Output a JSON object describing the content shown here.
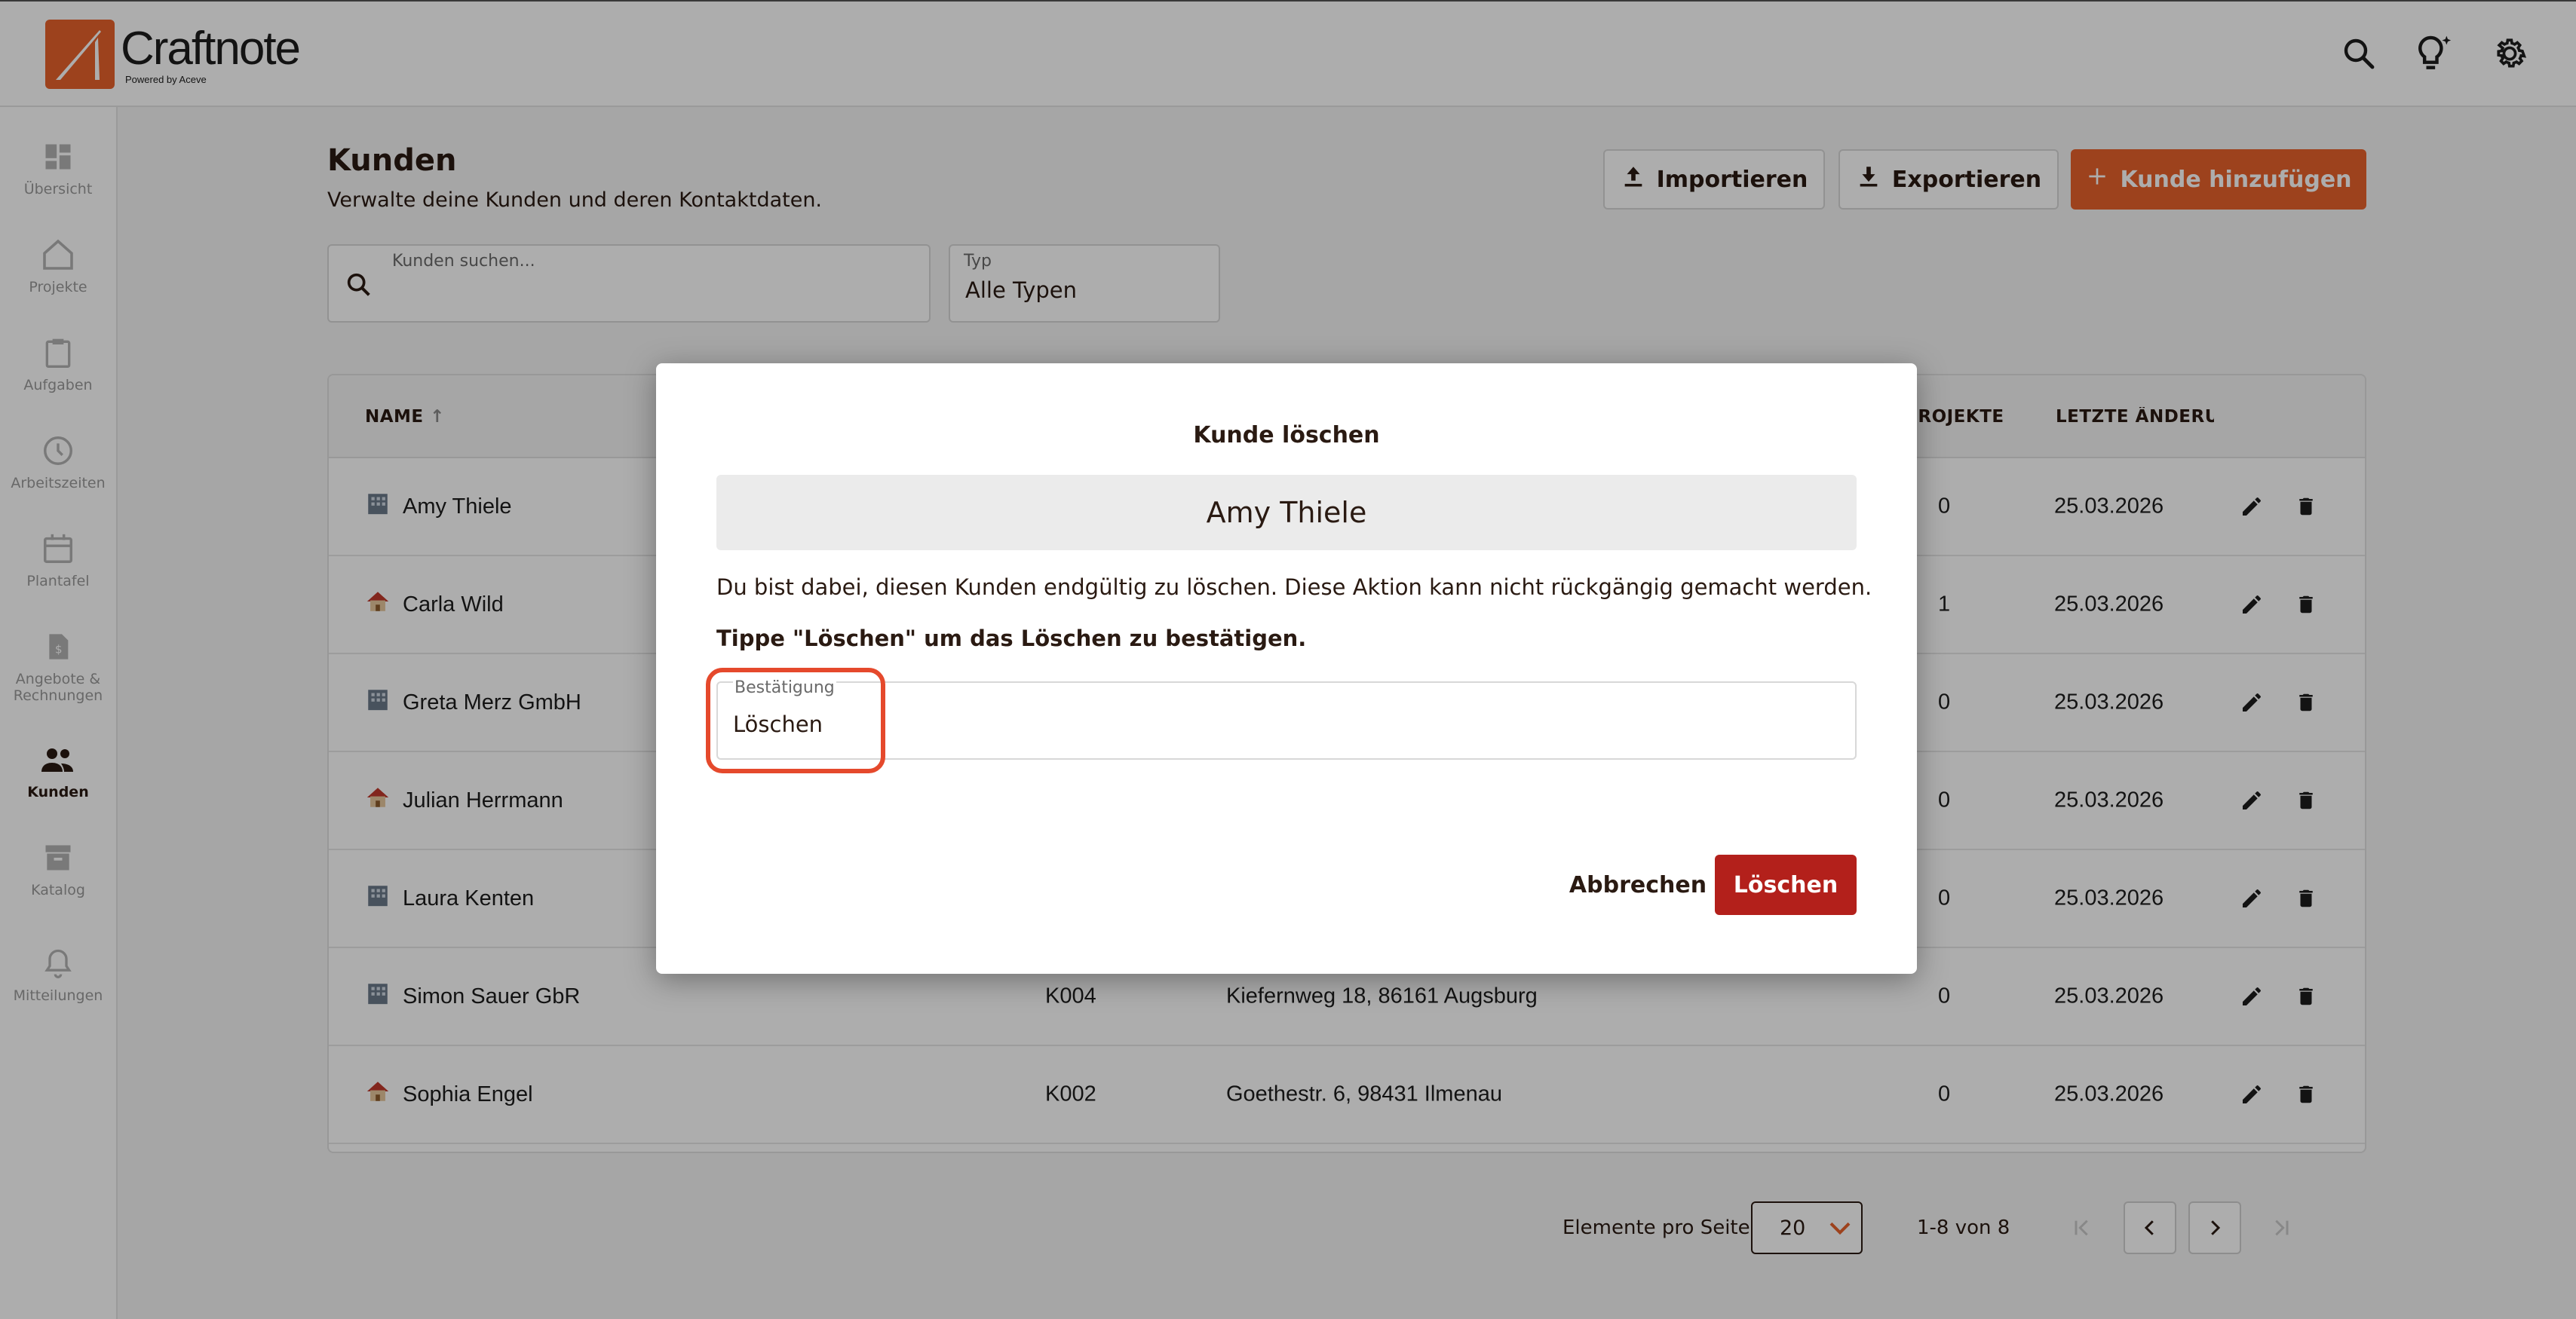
{
  "app": {
    "name": "Craftnote",
    "tagline": "Powered by Aceve"
  },
  "sidebar": {
    "items": [
      {
        "label": "Übersicht",
        "icon": "dashboard-icon"
      },
      {
        "label": "Projekte",
        "icon": "home-icon"
      },
      {
        "label": "Aufgaben",
        "icon": "clipboard-icon"
      },
      {
        "label": "Arbeitszeiten",
        "icon": "clock-icon"
      },
      {
        "label": "Plantafel",
        "icon": "calendar-icon"
      },
      {
        "label": "Angebote & Rechnungen",
        "icon": "invoice-icon"
      },
      {
        "label": "Kunden",
        "icon": "people-icon",
        "active": true
      },
      {
        "label": "Katalog",
        "icon": "archive-icon"
      },
      {
        "label": "Mitteilungen",
        "icon": "bell-icon"
      }
    ]
  },
  "header": {
    "title": "Kunden",
    "subtitle": "Verwalte deine Kunden und deren Kontaktdaten."
  },
  "toolbar": {
    "import_label": "Importieren",
    "export_label": "Exportieren",
    "add_label": "Kunde hinzufügen"
  },
  "filters": {
    "search_label": "Kunden suchen...",
    "type_label": "Typ",
    "type_value": "Alle Typen"
  },
  "table": {
    "columns": {
      "name": "NAME",
      "projects": "PROJEKTE",
      "changed": "LETZTE ÄNDERUNG"
    },
    "rows": [
      {
        "name": "Amy Thiele",
        "kind": "company",
        "number": "",
        "address": "",
        "projects": "0",
        "changed": "25.03.2026"
      },
      {
        "name": "Carla Wild",
        "kind": "private",
        "number": "",
        "address": "",
        "projects": "1",
        "changed": "25.03.2026"
      },
      {
        "name": "Greta Merz GmbH",
        "kind": "company",
        "number": "",
        "address": "",
        "projects": "0",
        "changed": "25.03.2026"
      },
      {
        "name": "Julian Herrmann",
        "kind": "private",
        "number": "",
        "address": "",
        "projects": "0",
        "changed": "25.03.2026"
      },
      {
        "name": "Laura Kenten",
        "kind": "company",
        "number": "",
        "address": "",
        "projects": "0",
        "changed": "25.03.2026"
      },
      {
        "name": "Simon Sauer GbR",
        "kind": "company",
        "number": "K004",
        "address": "Kiefernweg 18, 86161 Augsburg",
        "projects": "0",
        "changed": "25.03.2026"
      },
      {
        "name": "Sophia Engel",
        "kind": "private",
        "number": "K002",
        "address": "Goethestr. 6, 98431 Ilmenau",
        "projects": "0",
        "changed": "25.03.2026"
      }
    ]
  },
  "pagination": {
    "per_page_label": "Elemente pro Seite",
    "per_page": "20",
    "range": "1-8 von 8"
  },
  "dialog": {
    "title": "Kunde löschen",
    "customer_name": "Amy Thiele",
    "warning": "Du bist dabei, diesen Kunden endgültig zu löschen. Diese Aktion kann nicht rückgängig gemacht werden.",
    "instruction": "Tippe \"Löschen\" um das Löschen zu bestätigen.",
    "confirm_label": "Bestätigung",
    "confirm_value": "Löschen",
    "cancel_label": "Abbrechen",
    "delete_label": "Löschen"
  },
  "colors": {
    "accent": "#e8622c",
    "danger": "#b3201b",
    "highlight": "#e5492c"
  }
}
